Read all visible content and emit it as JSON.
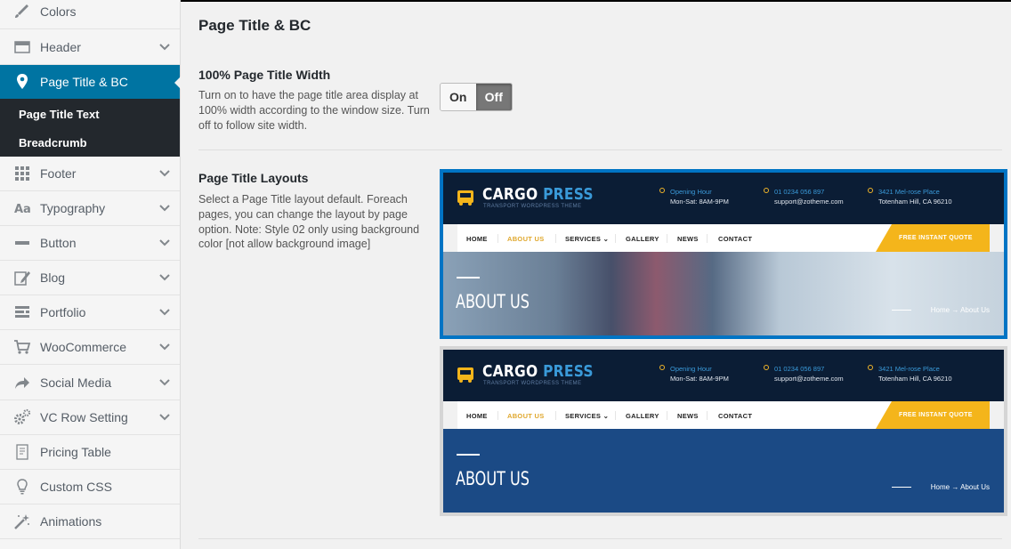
{
  "sidebar": {
    "items": [
      {
        "label": "Colors",
        "icon": "brush-icon",
        "chevron": false
      },
      {
        "label": "Header",
        "icon": "header-icon",
        "chevron": true
      },
      {
        "label": "Page Title & BC",
        "icon": "map-pin-icon",
        "chevron": false,
        "active": true
      },
      {
        "label": "Footer",
        "icon": "grid-icon",
        "chevron": true
      },
      {
        "label": "Typography",
        "icon": "typography-icon",
        "chevron": true
      },
      {
        "label": "Button",
        "icon": "button-icon",
        "chevron": true
      },
      {
        "label": "Blog",
        "icon": "edit-icon",
        "chevron": true
      },
      {
        "label": "Portfolio",
        "icon": "portfolio-icon",
        "chevron": true
      },
      {
        "label": "WooCommerce",
        "icon": "cart-icon",
        "chevron": true
      },
      {
        "label": "Social Media",
        "icon": "share-icon",
        "chevron": true
      },
      {
        "label": "VC Row Setting",
        "icon": "gears-icon",
        "chevron": true
      },
      {
        "label": "Pricing Table",
        "icon": "document-icon",
        "chevron": false
      },
      {
        "label": "Custom CSS",
        "icon": "lightbulb-icon",
        "chevron": false
      },
      {
        "label": "Animations",
        "icon": "magic-wand-icon",
        "chevron": false
      }
    ],
    "subitems": [
      "Page Title Text",
      "Breadcrumb"
    ]
  },
  "main": {
    "title": "Page Title & BC",
    "width_section": {
      "title": "100% Page Title Width",
      "desc": "Turn on to have the page title area display at 100% width according to the window size. Turn off to follow site width.",
      "on_label": "On",
      "off_label": "Off"
    },
    "layouts_section": {
      "title": "Page Title Layouts",
      "desc": "Select a Page Title layout default. Foreach pages, you can change the layout by page option. Note: Style 02 only using background color [not allow background image]"
    },
    "preview": {
      "logo_cargo": "CARGO",
      "logo_press": "PRESS",
      "tagline": "TRANSPORT WORDPRESS THEME",
      "info": [
        {
          "k": "Opening Hour",
          "v": "Mon-Sat: 8AM-9PM"
        },
        {
          "k": "01 0234 056 897",
          "v": "support@zotheme.com"
        },
        {
          "k": "3421 Mel-rose Place",
          "v": "Totenham Hill, CA 96210"
        }
      ],
      "nav": [
        "HOME",
        "ABOUT US",
        "SERVICES ⌄",
        "GALLERY",
        "NEWS",
        "CONTACT"
      ],
      "quote": "FREE INSTANT QUOTE",
      "heading": "ABOUT US",
      "crumb": "Home → About Us"
    }
  },
  "colors": {
    "active": "#0074a2",
    "selected_border": "#0074c4",
    "accent": "#f4b51b"
  }
}
